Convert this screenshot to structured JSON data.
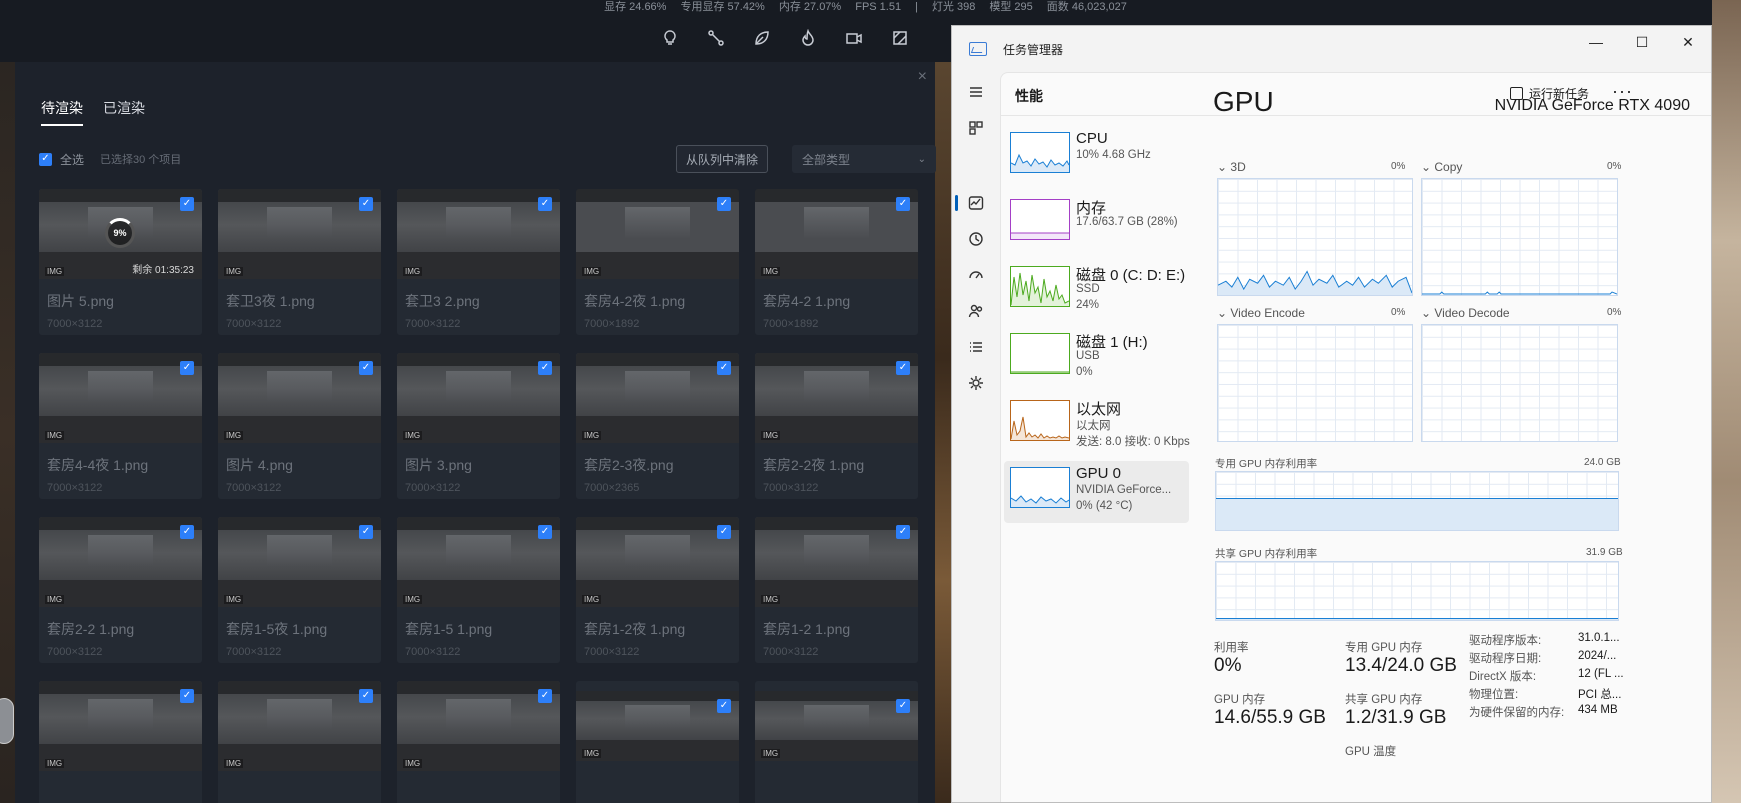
{
  "top_stats": [
    "显存 24.66%",
    "专用显存 57.42%",
    "内存 27.07%",
    "FPS 1.51",
    "|",
    "灯光 398",
    "模型 295",
    "面数 46,023,027"
  ],
  "toolbar_icons": [
    "lightbulb-icon",
    "path-icon",
    "leaf-icon",
    "fire-icon",
    "camera-icon",
    "layers-icon"
  ],
  "dialog": {
    "close": "×",
    "tabs": [
      "待渲染",
      "已渲染"
    ],
    "select_all_label": "全选",
    "selected_count": "已选择30 个项目",
    "remove_button": "从队列中清除",
    "type_select": "全部类型",
    "badge_img": "IMG",
    "items": [
      {
        "name": "图片 5.png",
        "size": "7000×3122",
        "progress": "9%",
        "remaining": "剩余 01:35:23"
      },
      {
        "name": "套卫3夜 1.png",
        "size": "7000×3122"
      },
      {
        "name": "套卫3 2.png",
        "size": "7000×3122"
      },
      {
        "name": "套房4-2夜 1.png",
        "size": "7000×1892"
      },
      {
        "name": "套房4-2 1.png",
        "size": "7000×1892"
      },
      {
        "name": "套房4-4夜 1.png",
        "size": "7000×3122"
      },
      {
        "name": "图片 4.png",
        "size": "7000×3122"
      },
      {
        "name": "图片 3.png",
        "size": "7000×3122"
      },
      {
        "name": "套房2-3夜.png",
        "size": "7000×2365"
      },
      {
        "name": "套房2-2夜 1.png",
        "size": "7000×3122"
      },
      {
        "name": "套房2-2 1.png",
        "size": "7000×3122"
      },
      {
        "name": "套房1-5夜 1.png",
        "size": "7000×3122"
      },
      {
        "name": "套房1-5 1.png",
        "size": "7000×3122"
      },
      {
        "name": "套房1-2夜 1.png",
        "size": "7000×3122"
      },
      {
        "name": "套房1-2 1.png",
        "size": "7000×3122"
      },
      {
        "name": "",
        "size": ""
      },
      {
        "name": "",
        "size": ""
      },
      {
        "name": "",
        "size": ""
      },
      {
        "name": "",
        "size": ""
      },
      {
        "name": "",
        "size": ""
      }
    ]
  },
  "task_manager": {
    "title": "任务管理器",
    "window_controls": [
      "—",
      "☐",
      "✕"
    ],
    "page_title": "性能",
    "run_new_task": "运行新任务",
    "more": "···",
    "devices": [
      {
        "name": "CPU",
        "line2": "10% 4.68 GHz",
        "line3": "",
        "color": "#1a7fd4"
      },
      {
        "name": "内存",
        "line2": "17.6/63.7 GB (28%)",
        "line3": "",
        "color": "#a43fc6"
      },
      {
        "name": "磁盘 0 (C: D: E:)",
        "line2": "SSD",
        "line3": "24%",
        "color": "#4caa1f"
      },
      {
        "name": "磁盘 1 (H:)",
        "line2": "USB",
        "line3": "0%",
        "color": "#4caa1f"
      },
      {
        "name": "以太网",
        "line2": "以太网",
        "line3": "发送: 8.0 接收: 0 Kbps",
        "color": "#b8651a"
      },
      {
        "name": "GPU 0",
        "line2": "NVIDIA GeForce...",
        "line3": "0% (42 °C)",
        "color": "#1a7fd4"
      }
    ],
    "gpu": {
      "heading": "GPU",
      "model": "NVIDIA GeForce RTX 4090",
      "engines": [
        {
          "label": "3D",
          "pct": "0%"
        },
        {
          "label": "Copy",
          "pct": "0%"
        },
        {
          "label": "Video Encode",
          "pct": "0%"
        },
        {
          "label": "Video Decode",
          "pct": "0%"
        }
      ],
      "dedicated_label": "专用 GPU 内存利用率",
      "dedicated_max": "24.0 GB",
      "dedicated_level": 0.56,
      "shared_label": "共享 GPU 内存利用率",
      "shared_max": "31.9 GB",
      "shared_level": 0.04,
      "stats": {
        "util_label": "利用率",
        "util_value": "0%",
        "ded_label": "专用 GPU 内存",
        "ded_value": "13.4/24.0 GB",
        "gmem_label": "GPU 内存",
        "gmem_value": "14.6/55.9 GB",
        "shmem_label": "共享 GPU 内存",
        "shmem_value": "1.2/31.9 GB",
        "temp_label": "GPU 温度"
      },
      "details": [
        {
          "k": "驱动程序版本:",
          "v": "31.0.1..."
        },
        {
          "k": "驱动程序日期:",
          "v": "2024/..."
        },
        {
          "k": "DirectX 版本:",
          "v": "12 (FL ..."
        },
        {
          "k": "物理位置:",
          "v": "PCI 总..."
        },
        {
          "k": "为硬件保留的内存:",
          "v": "434 MB"
        }
      ]
    }
  }
}
